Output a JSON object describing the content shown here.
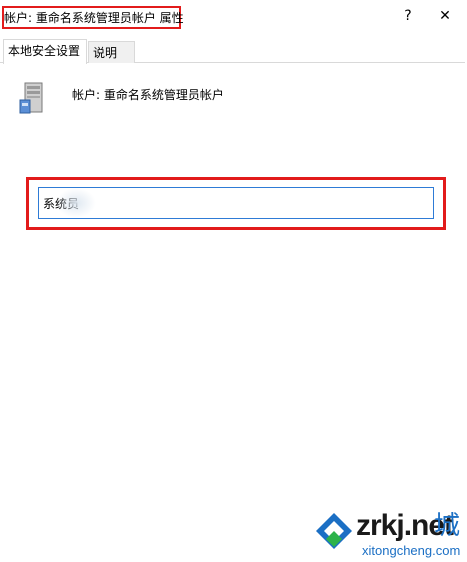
{
  "window": {
    "title": "帐户: 重命名系统管理员帐户 属性",
    "help_glyph": "?",
    "close_glyph": "✕"
  },
  "tabs": [
    {
      "label": "本地安全设置",
      "active": true
    },
    {
      "label": "说明",
      "active": false
    }
  ],
  "policy": {
    "icon": "server-icon",
    "label": "帐户: 重命名系统管理员帐户"
  },
  "account_field": {
    "value": "系统员"
  },
  "watermark": {
    "main": "zrkj.net",
    "cheng": "城",
    "sub": "xitongcheng.com",
    "colors": {
      "blue": "#1b6fc4",
      "green": "#2db34a",
      "dark": "#1a1a1a"
    }
  },
  "colors": {
    "highlight": "#e21b1b",
    "input_focus": "#2e7bd6",
    "tab_border": "#d9d9d9"
  }
}
